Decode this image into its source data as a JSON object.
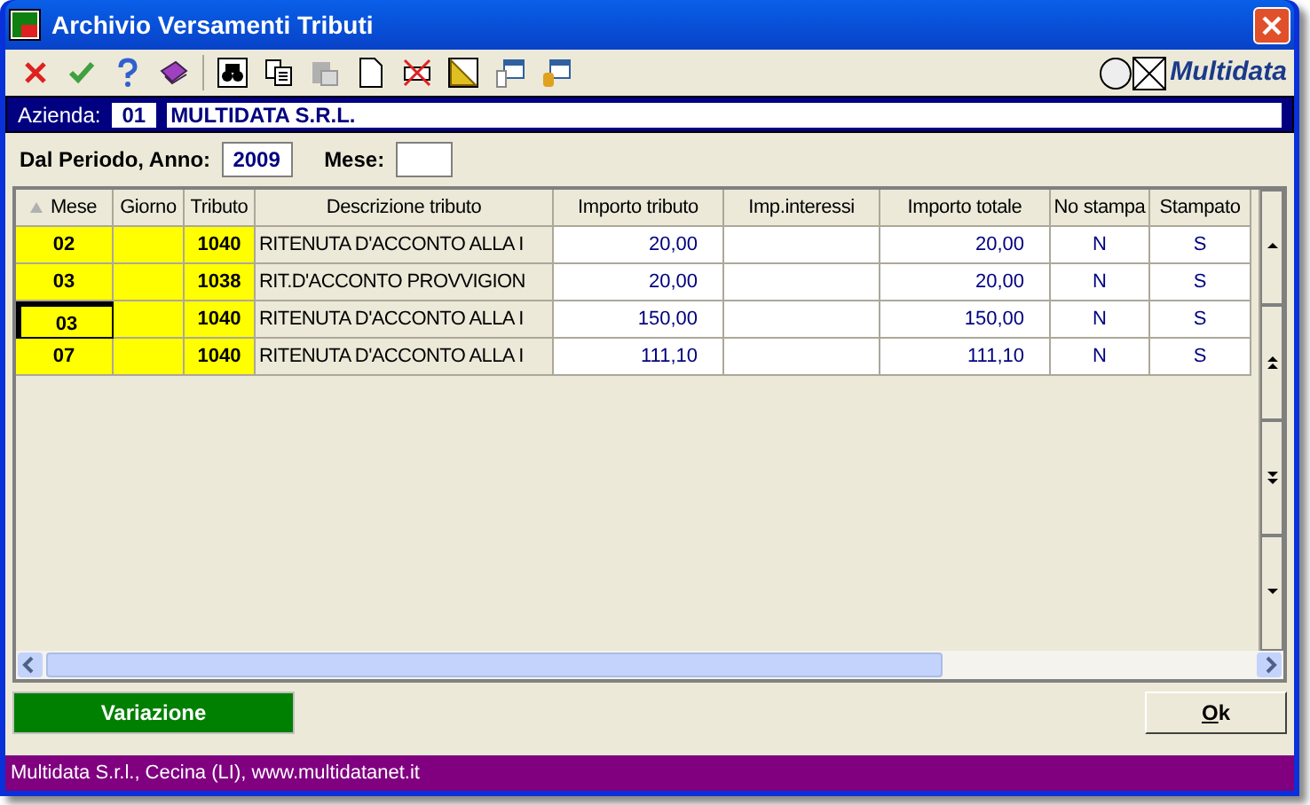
{
  "window": {
    "title": "Archivio Versamenti Tributi"
  },
  "logo": {
    "text": "Multidata"
  },
  "azienda": {
    "label": "Azienda:",
    "code": "01",
    "name": "MULTIDATA S.R.L."
  },
  "period": {
    "anno_label": "Dal Periodo, Anno:",
    "anno": "2009",
    "mese_label": "Mese:"
  },
  "table": {
    "columns": [
      {
        "label": "Mese",
        "sorted": true
      },
      {
        "label": "Giorno",
        "sorted": false
      },
      {
        "label": "Tributo",
        "sorted": false
      },
      {
        "label": "Descrizione tributo",
        "sorted": false
      },
      {
        "label": "Importo tributo",
        "sorted": false
      },
      {
        "label": "Imp.interessi",
        "sorted": false
      },
      {
        "label": "Importo totale",
        "sorted": false
      },
      {
        "label": "No stampa",
        "sorted": false
      },
      {
        "label": "Stampato",
        "sorted": false
      }
    ],
    "rows": [
      {
        "focused": false,
        "cells": [
          "02",
          "",
          "1040",
          "RITENUTA D'ACCONTO ALLA I",
          "20,00",
          "",
          "20,00",
          "N",
          "S"
        ]
      },
      {
        "focused": false,
        "cells": [
          "03",
          "",
          "1038",
          "RIT.D'ACCONTO PROVVIGION",
          "20,00",
          "",
          "20,00",
          "N",
          "S"
        ]
      },
      {
        "focused": true,
        "cells": [
          "03",
          "",
          "1040",
          "RITENUTA D'ACCONTO ALLA I",
          "150,00",
          "",
          "150,00",
          "N",
          "S"
        ]
      },
      {
        "focused": false,
        "cells": [
          "07",
          "",
          "1040",
          "RITENUTA D'ACCONTO ALLA I",
          "111,10",
          "",
          "111,10",
          "N",
          "S"
        ]
      }
    ]
  },
  "buttons": [
    {
      "label": "Variazione",
      "kind": "primary"
    },
    {
      "label": "Ok",
      "kind": "default"
    }
  ],
  "status_bar": "Multidata S.r.l., Cecina (LI), www.multidatanet.it"
}
